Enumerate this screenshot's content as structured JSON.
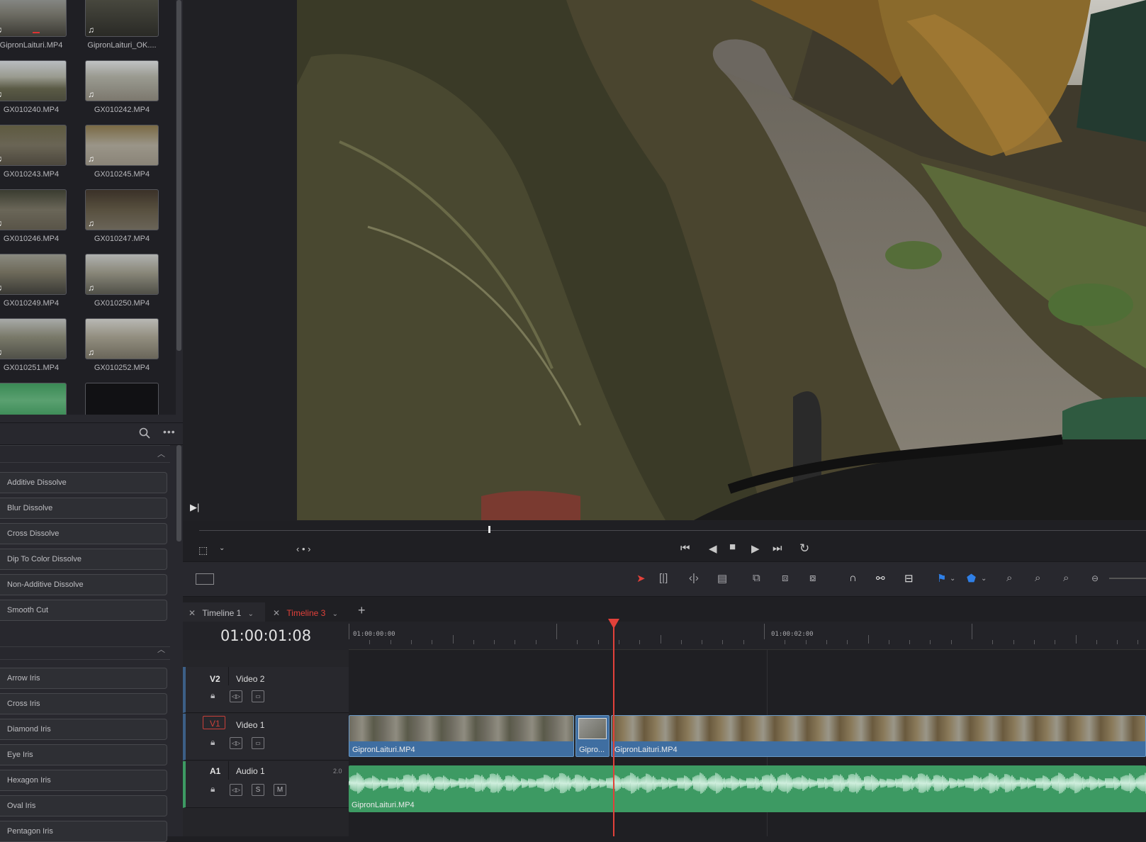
{
  "media_pool": {
    "clips": [
      {
        "label": "GipronLaituri.MP4"
      },
      {
        "label": "GipronLaituri_OK...."
      },
      {
        "label": "GX010240.MP4"
      },
      {
        "label": "GX010242.MP4"
      },
      {
        "label": "GX010243.MP4"
      },
      {
        "label": "GX010245.MP4"
      },
      {
        "label": "GX010246.MP4"
      },
      {
        "label": "GX010247.MP4"
      },
      {
        "label": "GX010249.MP4"
      },
      {
        "label": "GX010250.MP4"
      },
      {
        "label": "GX010251.MP4"
      },
      {
        "label": "GX010252.MP4"
      }
    ]
  },
  "effects": {
    "dissolve_group": [
      "Additive Dissolve",
      "Blur Dissolve",
      "Cross Dissolve",
      "Dip To Color Dissolve",
      "Non-Additive Dissolve",
      "Smooth Cut"
    ],
    "iris_group": [
      "Arrow Iris",
      "Cross Iris",
      "Diamond Iris",
      "Eye Iris",
      "Hexagon Iris",
      "Oval Iris",
      "Pentagon Iris"
    ]
  },
  "tabs": [
    {
      "label": "Timeline 1"
    },
    {
      "label": "Timeline 3"
    }
  ],
  "timeline": {
    "timecode": "01:00:01:08",
    "ruler_labels": [
      "01:00:00:00",
      "01:00:02:00"
    ],
    "tracks": {
      "v2": {
        "code": "V2",
        "name": "Video 2"
      },
      "v1": {
        "code": "V1",
        "name": "Video 1"
      },
      "a1": {
        "code": "A1",
        "name": "Audio 1",
        "channels": "2.0"
      }
    },
    "clips": {
      "v1_a": "GipronLaituri.MP4",
      "v1_b": "Gipro...",
      "v1_c": "GipronLaituri.MP4",
      "a1_a": "GipronLaituri.MP4"
    },
    "solo_label": "S",
    "mute_label": "M"
  },
  "colors": {
    "accent_red": "#e2413a",
    "video_clip": "#3f6ea1",
    "audio_clip": "#3d9a63",
    "flag_blue": "#2f7fe6"
  },
  "icons": [
    "music-note-icon",
    "search-icon",
    "more-icon",
    "chevron-up-icon",
    "skip-to-start-icon",
    "step-back-icon",
    "stop-icon",
    "play-icon",
    "skip-to-end-icon",
    "loop-icon",
    "selection-tool-icon",
    "snap-icon",
    "link-icon",
    "lock-icon",
    "flag-icon",
    "marker-icon",
    "zoom-icon",
    "close-icon",
    "add-icon"
  ]
}
